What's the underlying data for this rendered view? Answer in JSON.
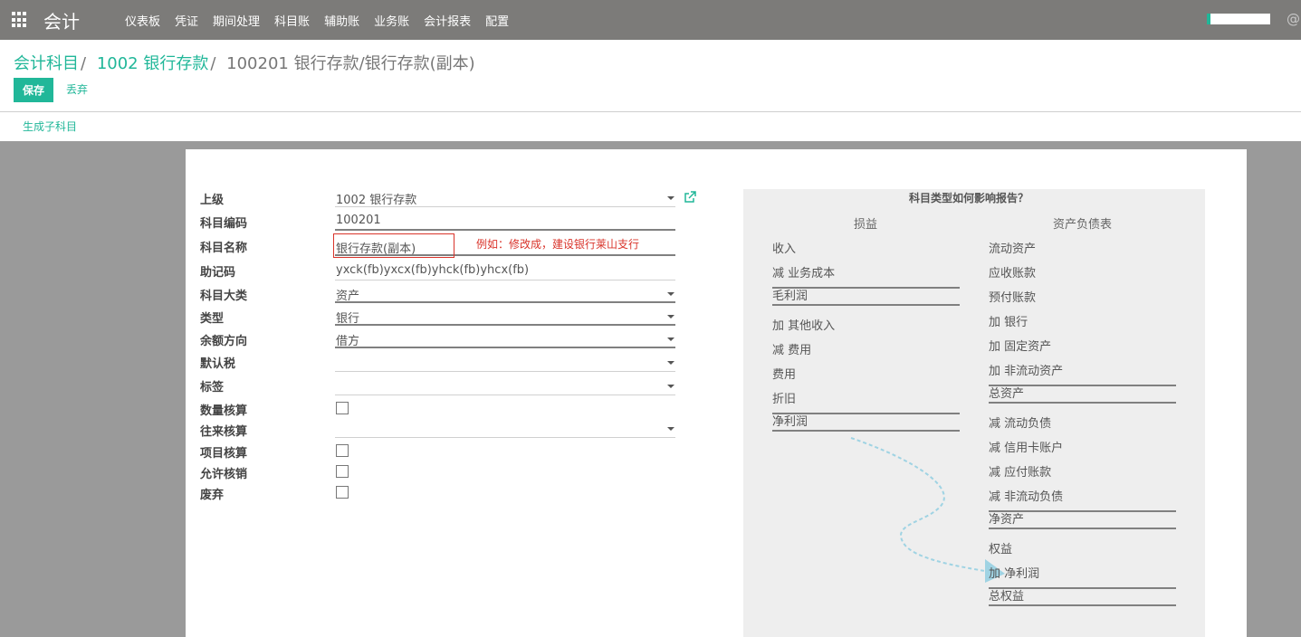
{
  "navbar": {
    "brand": "会计",
    "menu": [
      "仪表板",
      "凭证",
      "期间处理",
      "科目账",
      "辅助账",
      "业务账",
      "会计报表",
      "配置"
    ],
    "user_fragment": "@"
  },
  "breadcrumb": {
    "items": [
      "会计科目",
      "1002 银行存款"
    ],
    "separator": "/",
    "current": "100201 银行存款/银行存款(副本)"
  },
  "buttons": {
    "save": "保存",
    "discard": "丢弃",
    "create_child": "生成子科目"
  },
  "form": {
    "parent": {
      "label": "上级",
      "value": "1002 银行存款"
    },
    "code": {
      "label": "科目编码",
      "value": "100201"
    },
    "name": {
      "label": "科目名称",
      "value": "银行存款(副本)"
    },
    "mnemonic": {
      "label": "助记码",
      "value": "yxck(fb)yxcx(fb)yhck(fb)yhcx(fb)"
    },
    "category": {
      "label": "科目大类",
      "value": "资产"
    },
    "type": {
      "label": "类型",
      "value": "银行"
    },
    "balance_direction": {
      "label": "余额方向",
      "value": "借方"
    },
    "default_tax": {
      "label": "默认税",
      "value": ""
    },
    "tags": {
      "label": "标签",
      "value": ""
    },
    "quantity": {
      "label": "数量核算",
      "checked": false
    },
    "partner": {
      "label": "往来核算",
      "value": ""
    },
    "project": {
      "label": "项目核算",
      "checked": false
    },
    "reconcile": {
      "label": "允许核销",
      "checked": false
    },
    "deprecated": {
      "label": "废弃",
      "checked": false
    }
  },
  "annotation": "例如：修改成，建设银行莱山支行",
  "help": {
    "title": "科目类型如何影响报告？",
    "pnl_title": "损益",
    "bs_title": "资产负债表",
    "pnl": {
      "income": "收入",
      "cost": "减 业务成本",
      "gross": "毛利润",
      "other_income": "加 其他收入",
      "expense1": "减 费用",
      "expense2": "费用",
      "depreciation": "折旧",
      "net": "净利润"
    },
    "bs": {
      "current_assets": "流动资产",
      "receivable": "应收账款",
      "prepayments": "预付账款",
      "bank": "加 银行",
      "fixed_assets": "加 固定资产",
      "non_current_assets": "加 非流动资产",
      "total_assets": "总资产",
      "current_liab": "减 流动负债",
      "credit_card": "减 信用卡账户",
      "payable": "减 应付账款",
      "non_current_liab": "减 非流动负债",
      "net_assets": "净资产",
      "equity": "权益",
      "plus_net_profit": "加 净利润",
      "total_equity": "总权益"
    }
  },
  "colors": {
    "navbar": "#7c7b79",
    "accent": "#21b799",
    "annotation": "#d9342b",
    "help_bg": "#eeeeee",
    "content_bg": "#9a9a9a"
  }
}
